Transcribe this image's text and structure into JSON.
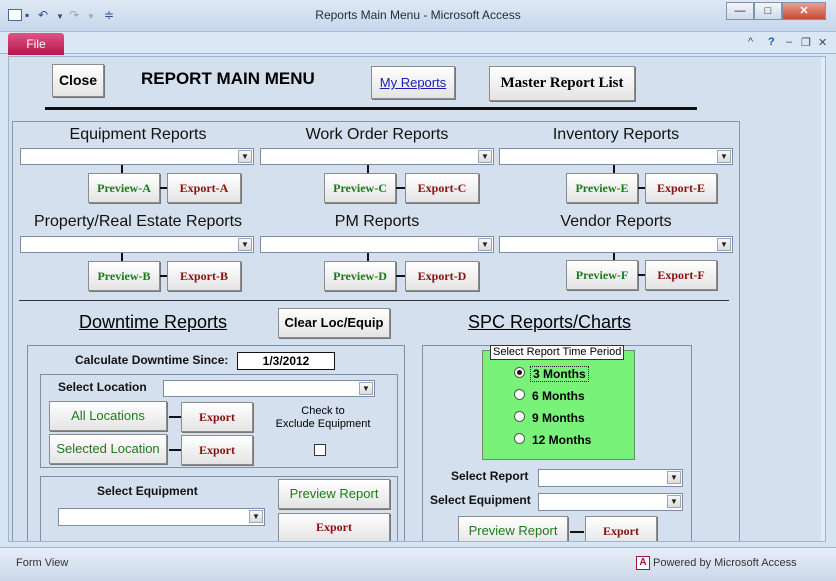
{
  "window": {
    "title": "Reports Main Menu  -  Microsoft Access",
    "file_tab": "File",
    "minimize": "—",
    "maximize": "□",
    "close": "✕",
    "help": "?",
    "doc_min": "–",
    "doc_restore": "❐",
    "doc_close": "✕",
    "expand": "^"
  },
  "header": {
    "close_label": "Close",
    "title": "REPORT MAIN MENU",
    "my_reports": "My Reports",
    "master_report_list": "Master Report List"
  },
  "groups": [
    {
      "title": "Equipment Reports",
      "preview": "Preview-A",
      "export": "Export-A"
    },
    {
      "title": "Work Order Reports",
      "preview": "Preview-C",
      "export": "Export-C"
    },
    {
      "title": "Inventory Reports",
      "preview": "Preview-E",
      "export": "Export-E"
    },
    {
      "title": "Property/Real Estate  Reports",
      "preview": "Preview-B",
      "export": "Export-B"
    },
    {
      "title": "PM Reports",
      "preview": "Preview-D",
      "export": "Export-D"
    },
    {
      "title": "Vendor Reports",
      "preview": "Preview-F",
      "export": "Export-F"
    }
  ],
  "downtime": {
    "title": "Downtime Reports",
    "clear_button": "Clear Loc/Equip",
    "calc_label": "Calculate Downtime Since:",
    "calc_value": "1/3/2012",
    "select_location": "Select Location",
    "all_locations": "All Locations",
    "selected_location": "Selected Location",
    "export": "Export",
    "check_label": "Check to\nExclude Equipment",
    "exclude_checked": false,
    "select_equipment": "Select Equipment",
    "preview_report": "Preview Report"
  },
  "spc": {
    "title": "SPC Reports/Charts",
    "period_label": "Select Report Time Period",
    "periods": [
      "3 Months",
      "6 Months",
      "9 Months",
      "12 Months"
    ],
    "selected_period": "3 Months",
    "select_report": "Select Report",
    "select_equipment": "Select Equipment",
    "preview_report": "Preview Report",
    "export": "Export"
  },
  "status": {
    "left": "Form View",
    "right": "Powered by Microsoft Access",
    "access_icon": "A"
  },
  "colors": {
    "preview_text": "#1c7a1c",
    "export_text": "#8b0f0f",
    "period_bg": "#79f279",
    "form_bg": "#d4e0ee"
  }
}
